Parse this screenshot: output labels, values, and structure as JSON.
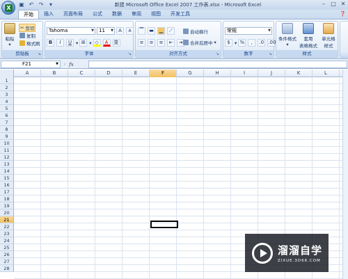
{
  "window": {
    "title": "新建 Microsoft Office Excel 2007 工作表.xlsx - Microsoft Excel",
    "qat_icons": [
      "save-icon",
      "undo-icon",
      "redo-icon",
      "dropdown-icon"
    ]
  },
  "tabs": [
    "开始",
    "插入",
    "页面布局",
    "公式",
    "数据",
    "审阅",
    "视图",
    "开发工具"
  ],
  "active_tab": "开始",
  "ribbon": {
    "clipboard": {
      "label": "剪贴板",
      "paste": "粘贴",
      "cut": "剪切",
      "copy": "复制",
      "format_painter": "格式刷"
    },
    "font": {
      "label": "字体",
      "font_name": "Tahoma",
      "font_size": "11",
      "grow": "A",
      "shrink": "A",
      "bold": "B",
      "italic": "I",
      "underline": "U",
      "font_color_glyph": "A",
      "phonetic": "变"
    },
    "alignment": {
      "label": "对齐方式",
      "wrap_text": "自动换行",
      "merge_center": "合并后居中"
    },
    "number": {
      "label": "数字",
      "format": "常规",
      "percent": "%",
      "comma": ","
    },
    "styles": {
      "label": "样式",
      "conditional": "条件格式",
      "table_format_1": "套用",
      "table_format_2": "表格格式",
      "cell_styles_1": "单元格",
      "cell_styles_2": "样式"
    }
  },
  "formula_bar": {
    "name_box": "F21",
    "fx": "fx",
    "value": ""
  },
  "grid": {
    "columns": [
      "A",
      "B",
      "C",
      "D",
      "E",
      "F",
      "G",
      "H",
      "I",
      "J",
      "K",
      "L"
    ],
    "rows": [
      "1",
      "2",
      "3",
      "4",
      "5",
      "6",
      "7",
      "8",
      "9",
      "10",
      "11",
      "12",
      "13",
      "14",
      "15",
      "16",
      "17",
      "18",
      "19",
      "20",
      "21",
      "22",
      "23",
      "24",
      "25",
      "26",
      "27",
      "28"
    ],
    "selected_column": "F",
    "selected_row": "21"
  },
  "watermark": {
    "main": "溜溜自学",
    "sub": "ZIXUE.3D66.COM"
  },
  "colors": {
    "accent": "#15428b",
    "selection": "#f1c15f"
  }
}
